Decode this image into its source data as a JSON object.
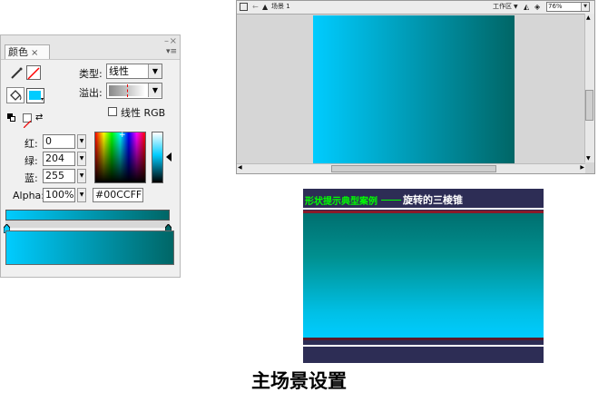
{
  "color_panel": {
    "tab_label": "颜色",
    "tab_close": "×",
    "min_icon": "–",
    "close_icon": "×",
    "menu_icon": "▾≡",
    "type_label": "类型:",
    "type_value": "线性",
    "overflow_label": "溢出:",
    "linear_rgb_label": "线性 RGB",
    "red_label": "红:",
    "red_value": "0",
    "green_label": "绿:",
    "green_value": "204",
    "blue_label": "蓝:",
    "blue_value": "255",
    "alpha_label": "Alpha:",
    "alpha_value": "100%",
    "hex_value": "#00CCFF",
    "fill_color": "#00ccff",
    "gradient_start": "#00ccff",
    "gradient_end": "#006666"
  },
  "stage": {
    "scene_label": "场景 1",
    "workspace_label": "工作区",
    "zoom_value": "76%",
    "up_arrow": "▲",
    "down_arrow": "▼",
    "left_arrow": "◀",
    "right_arrow": "▶",
    "gradient_start": "#00ccff",
    "gradient_end": "#006666"
  },
  "preview": {
    "banner_left": "形状提示典型案例",
    "banner_right": "旋转的三棱锥",
    "accent_color": "#00ff00"
  },
  "caption": "主场景设置"
}
